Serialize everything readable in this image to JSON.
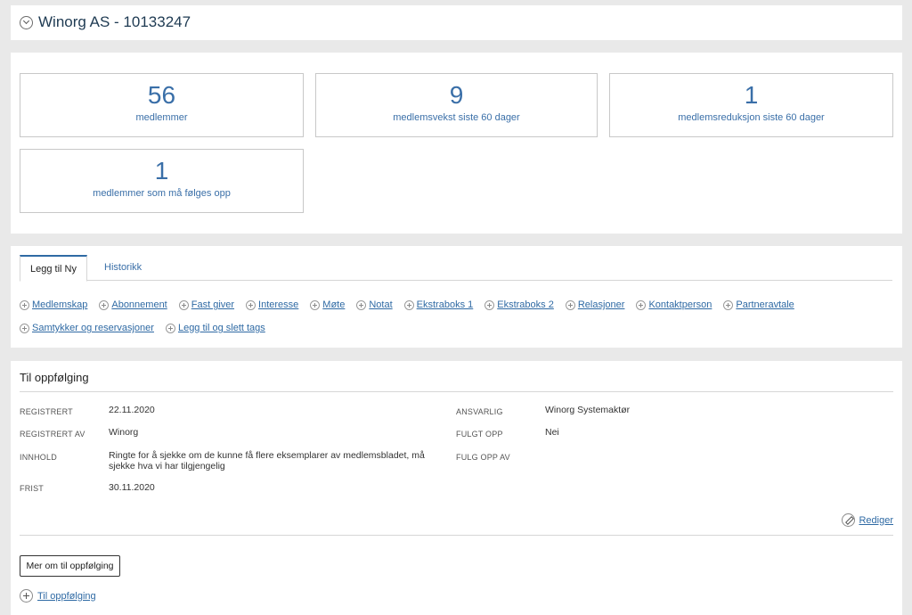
{
  "header": {
    "title": "Winorg AS - 10133247",
    "toggle_icon": "chevron-down-circle-icon"
  },
  "stats": [
    {
      "value": "56",
      "label": "medlemmer"
    },
    {
      "value": "9",
      "label": "medlemsvekst siste 60 dager"
    },
    {
      "value": "1",
      "label": "medlemsreduksjon siste 60 dager"
    },
    {
      "value": "1",
      "label": "medlemmer som må følges opp"
    }
  ],
  "tabs": [
    {
      "label": "Legg til Ny",
      "active": true
    },
    {
      "label": "Historikk",
      "active": false
    }
  ],
  "add_links_row1": [
    "Medlemskap",
    "Abonnement",
    "Fast giver",
    "Interesse",
    "Møte",
    "Notat",
    "Ekstraboks 1",
    "Ekstraboks 2",
    "Relasjoner",
    "Kontaktperson",
    "Partneravtale"
  ],
  "add_links_row2": [
    "Samtykker og reservasjoner",
    "Legg til og slett tags"
  ],
  "followup": {
    "title": "Til oppfølging",
    "registrert_label": "REGISTRERT",
    "registrert_value": "22.11.2020",
    "registrert_av_label": "REGISTRERT AV",
    "registrert_av_value": "Winorg",
    "innhold_label": "INNHOLD",
    "innhold_value_line1": "Ringte for å sjekke om de kunne få flere eksemplarer av medlemsbladet, må",
    "innhold_value_line2": "sjekke hva vi har tilgjengelig",
    "frist_label": "FRIST",
    "frist_value": "30.11.2020",
    "ansvarlig_label": "ANSVARLIG",
    "ansvarlig_value": "Winorg Systemaktør",
    "fulgt_opp_label": "FULGT OPP",
    "fulgt_opp_value": "Nei",
    "fulg_opp_av_label": "FULG OPP AV",
    "edit_label": "Rediger",
    "more_button_label": "Mer om til oppfølging",
    "add_followup_label": "Til oppfølging"
  },
  "colors": {
    "accent": "#2f6aa4",
    "stat_text": "#3a6fa8",
    "background": "#e9e9e9"
  }
}
